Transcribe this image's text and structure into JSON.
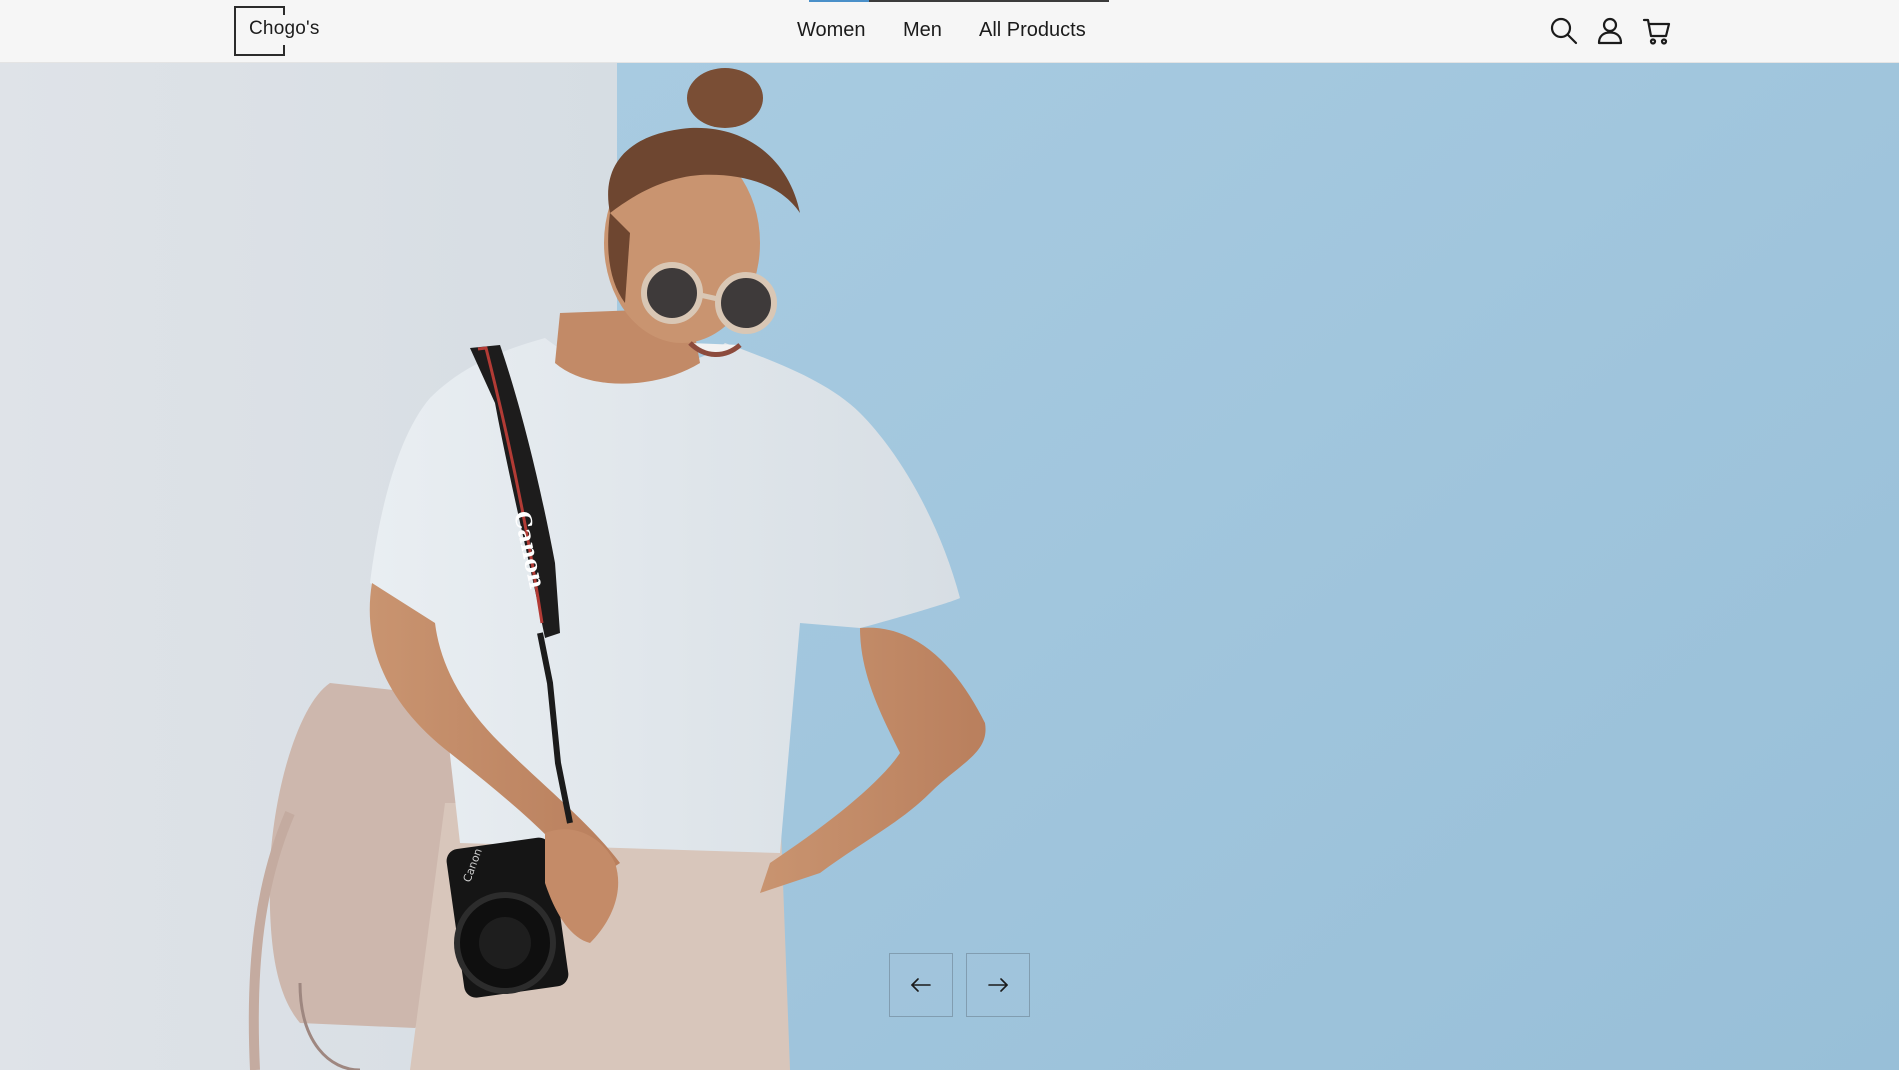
{
  "header": {
    "logo_text": "Chogo's",
    "nav": [
      {
        "label": "Women"
      },
      {
        "label": "Men"
      },
      {
        "label": "All Products"
      }
    ],
    "slide_progress": 0.2,
    "icons": [
      "search-icon",
      "user-icon",
      "cart-icon"
    ]
  },
  "hero": {
    "strap_text": "Canon",
    "camera_text": "Canon",
    "controls": {
      "prev_icon": "arrow-left-icon",
      "next_icon": "arrow-right-icon"
    }
  },
  "colors": {
    "header_bg": "#f6f6f6",
    "wall_light": "#dfe3e7",
    "wall_blue": "#a4c8de",
    "progress_accent": "#4a90c9"
  }
}
